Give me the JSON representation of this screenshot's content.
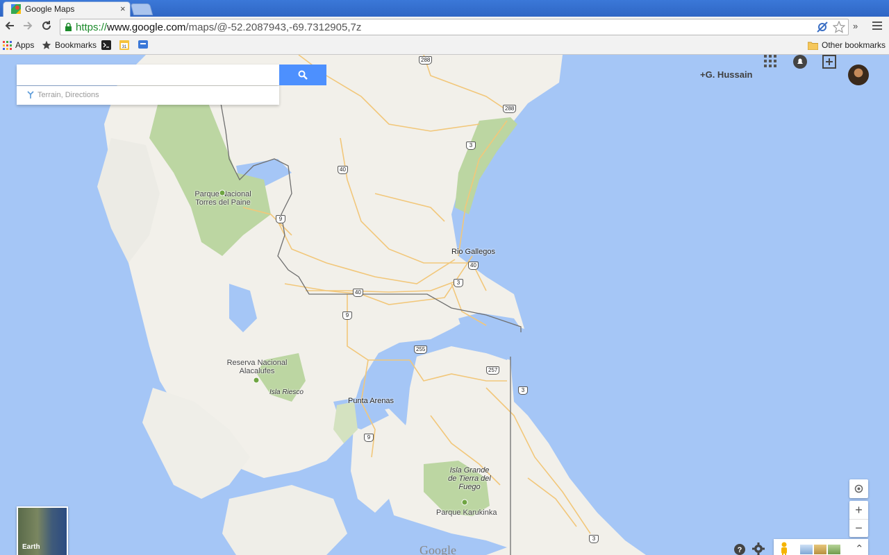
{
  "browser": {
    "tab_title": "Google Maps",
    "tab_close": "×",
    "url_scheme": "https://",
    "url_host": "www.google.com",
    "url_path": "/maps/@-52.2087943,-69.7312905,7z",
    "overflow": "»"
  },
  "bookmarks_bar": {
    "apps": "Apps",
    "bookmarks": "Bookmarks",
    "other": "Other bookmarks"
  },
  "search": {
    "value": "",
    "suggestion": "Terrain, Directions"
  },
  "account": {
    "name": "+G. Hussain"
  },
  "map": {
    "labels": {
      "torres_del_paine": "Parque Nacional Torres del Paine",
      "rio_gallegos": "Rio Gallegos",
      "alacalufes": "Reserva Nacional Alacalufes",
      "isla_riesco": "Isla Riesco",
      "punta_arenas": "Punta Arenas",
      "tierra_del_fuego": "Isla Grande de Tierra del Fuego",
      "karukinka": "Parque Karukinka"
    },
    "route_shields": [
      "288",
      "288",
      "3",
      "40",
      "9",
      "40",
      "40",
      "3",
      "9",
      "255",
      "257",
      "3",
      "9",
      "3"
    ],
    "earth_label": "Earth",
    "logo": "Google"
  },
  "controls": {
    "zoom_in": "+",
    "zoom_out": "−",
    "help": "?",
    "expand": "⌃"
  },
  "colors": {
    "water": "#9ec1f6",
    "land": "#f2f0ea",
    "park": "#bcd6a2",
    "road": "#f2c77a",
    "border": "#6f6f6f",
    "accent": "#4d90fe"
  }
}
